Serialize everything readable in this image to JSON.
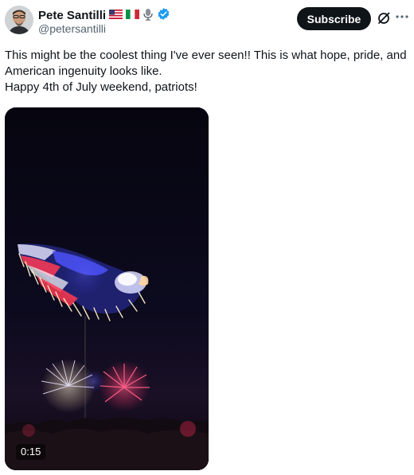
{
  "tweet": {
    "author": {
      "display_name": "Pete Santilli",
      "handle": "@petersantilli",
      "badges": [
        "us-flag-emoji",
        "italy-flag-emoji",
        "microphone-emoji",
        "verified-badge"
      ]
    },
    "subscribe_label": "Subscribe",
    "text_lines": [
      "This might be the coolest thing I've ever seen!! This is what hope, pride, and American ingenuity looks like.",
      "Happy 4th of July weekend, patriots!"
    ],
    "video": {
      "duration": "0:15",
      "scene": "drone show eagle over fireworks"
    }
  },
  "colors": {
    "subscribe_bg": "#0f1419",
    "verified": "#1d9bf0",
    "secondary_text": "#536471"
  },
  "icons": {
    "grok": "grok-icon",
    "more": "more-options-icon",
    "verified": "verified-badge-icon"
  }
}
